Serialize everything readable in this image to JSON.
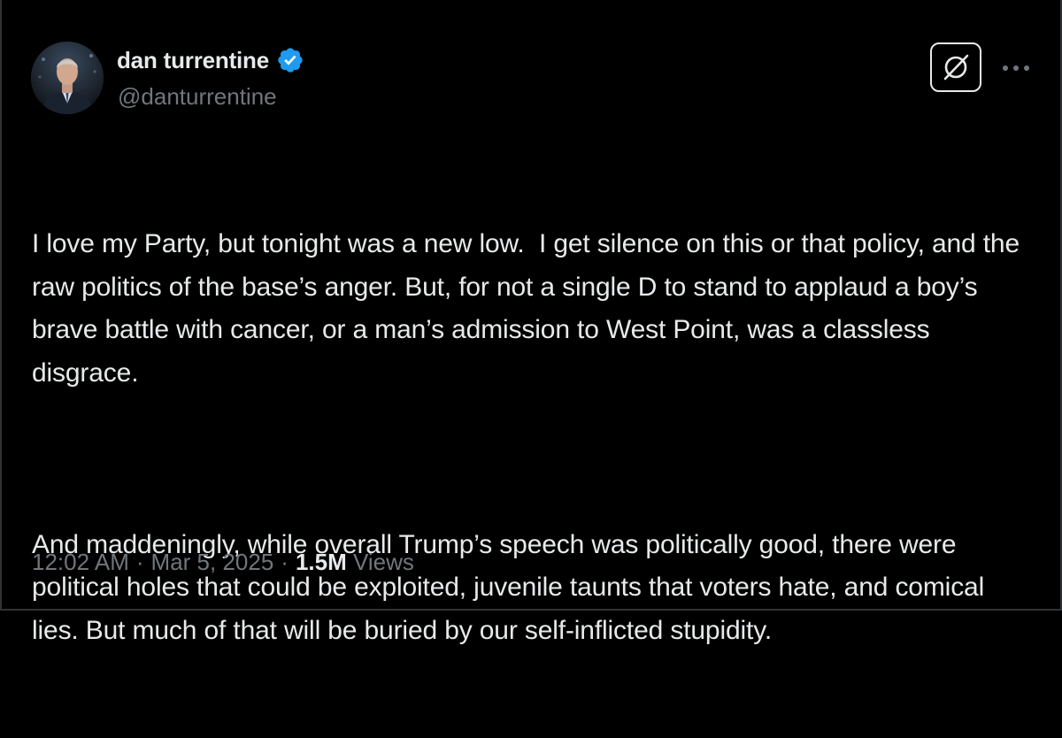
{
  "author": {
    "display_name": "dan turrentine",
    "handle": "@danturrentine",
    "verified": true
  },
  "tweet": {
    "paragraphs": [
      "I love my Party, but tonight was a new low.  I get silence on this or that policy, and the raw politics of the base’s anger. But, for not a single D to stand to applaud a boy’s brave battle with cancer, or a man’s admission to West Point, was a classless disgrace.",
      "And maddeningly, while overall Trump’s speech was politically good, there were political holes that could be exploited, juvenile taunts that voters hate, and comical lies. But much of that will be buried by our self-inflicted stupidity."
    ]
  },
  "meta": {
    "time": "12:02 AM",
    "separator": "·",
    "date": "Mar 5, 2025",
    "views_count": "1.5M",
    "views_label": "Views"
  },
  "icons": {
    "verified": "verified-badge-icon",
    "grok": "grok-icon",
    "more": "more-options-icon"
  },
  "colors": {
    "background": "#000000",
    "text_primary": "#e7e9ea",
    "text_secondary": "#71767b",
    "verified_blue": "#1d9bf0"
  }
}
